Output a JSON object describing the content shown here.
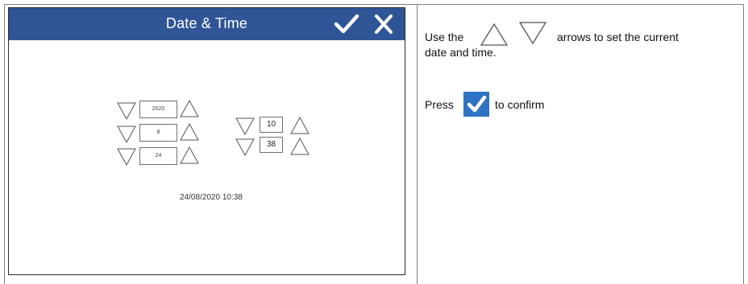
{
  "device_screen": {
    "title": "Date & Time",
    "confirm_icon": "check-icon",
    "close_icon": "close-icon",
    "colors": {
      "titlebar": "#2f5597",
      "title_text": "#ffffff"
    },
    "date_fields": {
      "year": "2020",
      "month": "8",
      "day": "24"
    },
    "time_fields": {
      "hour": "10",
      "minute": "38"
    },
    "arrow_icons": {
      "decrement": "triangle-down-icon",
      "increment": "triangle-up-icon"
    },
    "current_datetime": "24/08/2020 10:38"
  },
  "instructions": {
    "line1_prefix": "Use the",
    "line1_suffix": "arrows to set the current",
    "line2": "date and time.",
    "line3_prefix": "Press",
    "line3_suffix": "to confirm",
    "colors": {
      "check_badge": "#2e74c3"
    }
  }
}
